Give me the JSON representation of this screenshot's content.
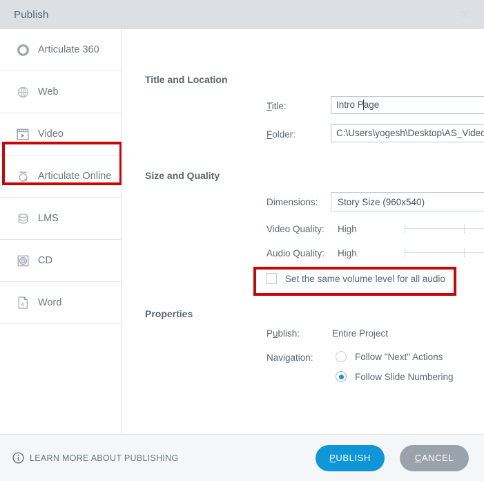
{
  "window": {
    "title": "Publish",
    "close_icon": "close-icon"
  },
  "sidebar": {
    "items": [
      {
        "label": "Articulate 360",
        "icon": "circle-ring-icon",
        "selected": false
      },
      {
        "label": "Web",
        "icon": "globe-icon",
        "selected": false
      },
      {
        "label": "Video",
        "icon": "film-play-icon",
        "selected": true
      },
      {
        "label": "Articulate Online",
        "icon": "articulate-online-icon",
        "selected": false
      },
      {
        "label": "LMS",
        "icon": "database-icon",
        "selected": false
      },
      {
        "label": "CD",
        "icon": "disc-icon",
        "selected": false
      },
      {
        "label": "Word",
        "icon": "word-document-icon",
        "selected": false
      }
    ]
  },
  "content": {
    "title_location": {
      "heading": "Title and Location",
      "title_label": "Title:",
      "title_value": "Intro P",
      "title_value_after_caret": "age",
      "folder_label": "Folder:",
      "folder_value": "C:\\Users\\yogesh\\Desktop\\AS_Video",
      "browse_label": "..."
    },
    "size_quality": {
      "heading": "Size and Quality",
      "dimensions_label": "Dimensions:",
      "dimensions_value": "Story Size (960x540)",
      "video_quality_label": "Video Quality:",
      "video_quality_value": "High",
      "audio_quality_label": "Audio Quality:",
      "audio_quality_value": "High",
      "same_volume_label": "Set the same volume level for all audio",
      "same_volume_checked": false
    },
    "properties": {
      "heading": "Properties",
      "publish_label": "Publish:",
      "publish_value": "Entire Project",
      "navigation_label": "Navigation:",
      "nav_option_1": "Follow \"Next\" Actions",
      "nav_option_2": "Follow Slide Numbering",
      "nav_selected": "Follow Slide Numbering"
    }
  },
  "footer": {
    "learn_more": "LEARN MORE ABOUT PUBLISHING",
    "info_icon": "info-icon",
    "publish_button_first": "P",
    "publish_button_rest": "UBLISH",
    "cancel_button_first": "C",
    "cancel_button_rest": "ANCEL"
  },
  "colors": {
    "accent": "#0f96d8",
    "slider": "#1f8fd6",
    "highlight_box": "#c90606",
    "titlebar": "#dce0e5",
    "footer": "#f5f6f7",
    "text": "#5c6670"
  }
}
